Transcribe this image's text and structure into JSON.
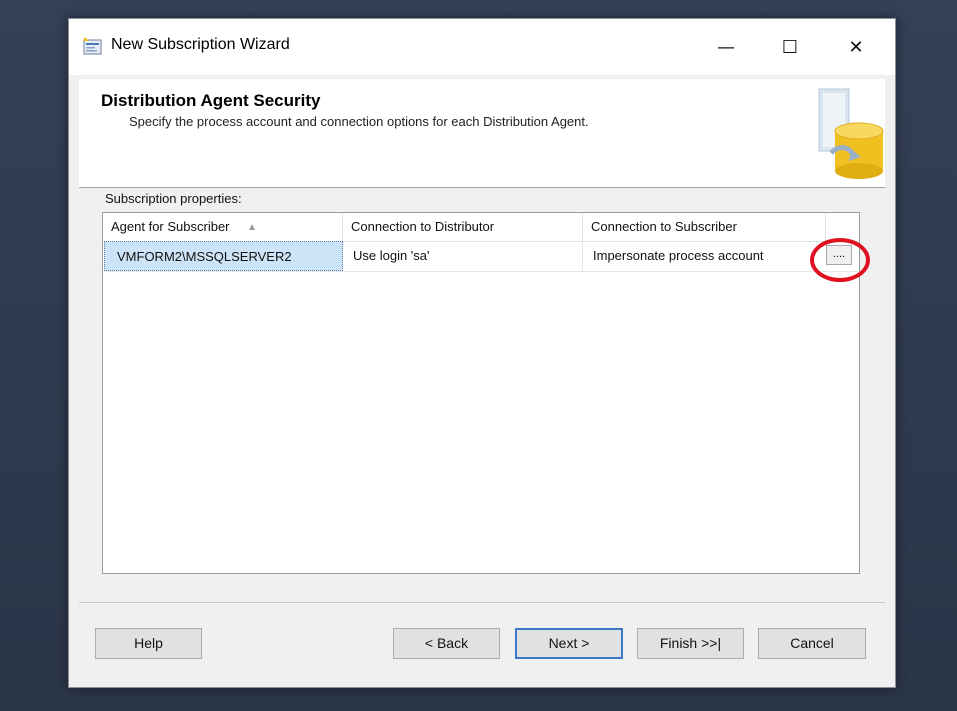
{
  "window": {
    "title": "New Subscription Wizard",
    "controls": {
      "minimize": "—",
      "maximize": "☐",
      "close": "✕"
    }
  },
  "header": {
    "title": "Distribution Agent Security",
    "subtitle": "Specify the process account and connection options for each Distribution Agent."
  },
  "grid": {
    "label": "Subscription properties:",
    "columns": [
      "Agent for Subscriber",
      "Connection to Distributor",
      "Connection to Subscriber"
    ],
    "rows": [
      {
        "agent": "VMFORM2\\MSSQLSERVER2",
        "distributor_connection": "Use login 'sa'",
        "subscriber_connection": "Impersonate process account",
        "browse_label": "...."
      }
    ]
  },
  "buttons": {
    "help": "Help",
    "back": "< Back",
    "next": "Next >",
    "finish": "Finish >>|",
    "cancel": "Cancel"
  },
  "colors": {
    "highlight_circle": "#e01020",
    "selected_cell": "#cde3f7",
    "default_button_border": "#3c78c8"
  },
  "icons": {
    "title": "wizard-window-icon",
    "header": "database-wizard-graphic",
    "sort": "sort-ascending-icon"
  }
}
